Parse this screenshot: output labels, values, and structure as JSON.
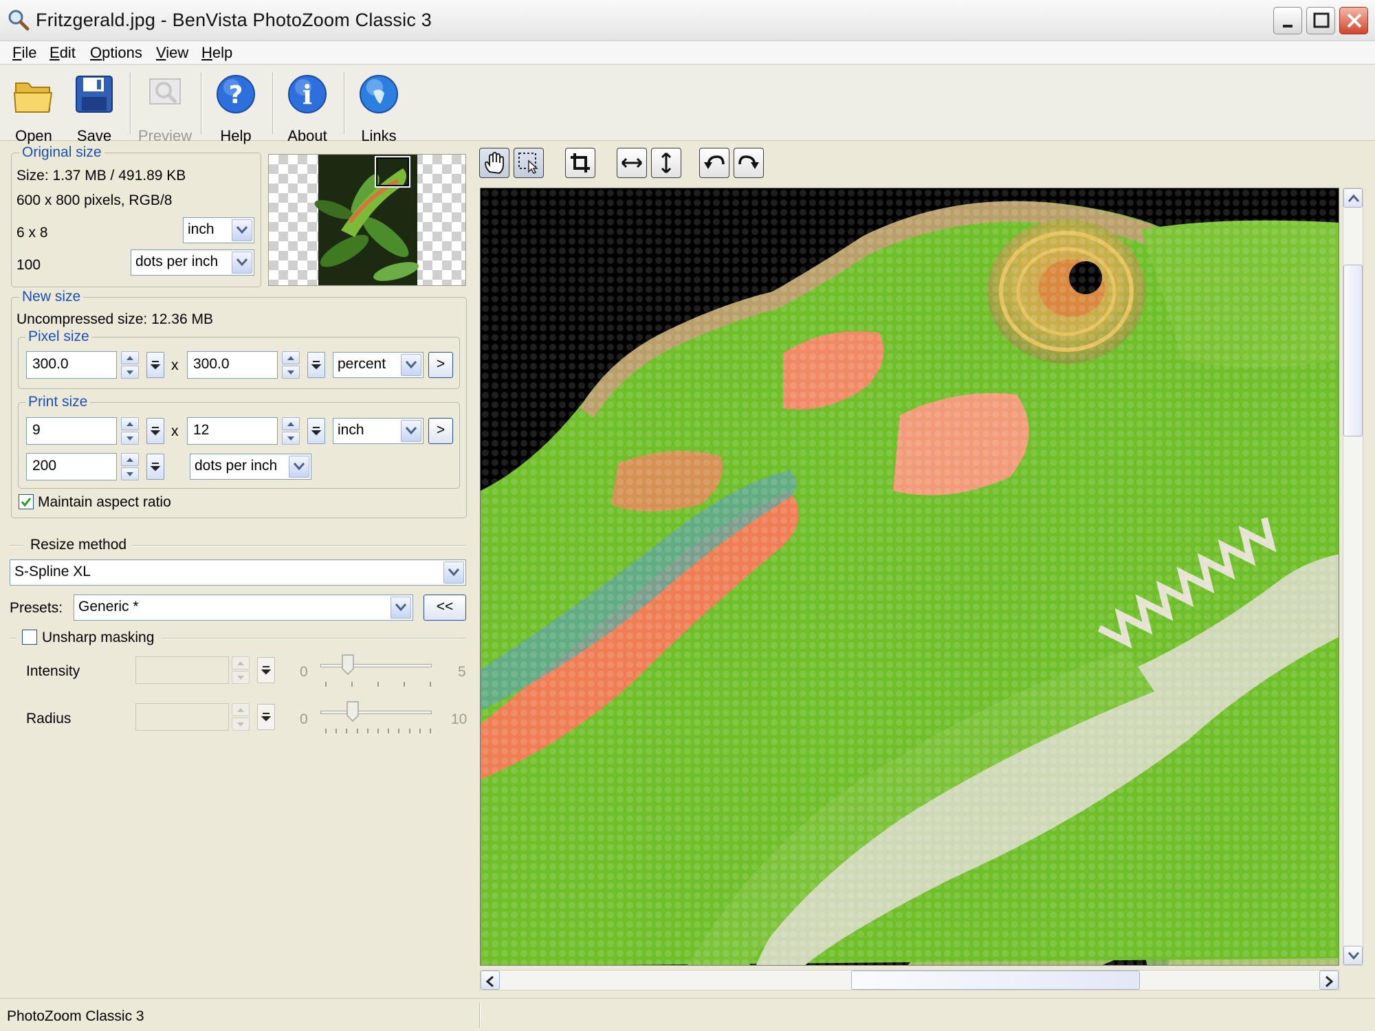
{
  "window": {
    "title": "Fritzgerald.jpg - BenVista PhotoZoom Classic 3"
  },
  "menu": {
    "file": "File",
    "edit": "Edit",
    "options": "Options",
    "view": "View",
    "help": "Help"
  },
  "toolbar": {
    "open": "Open",
    "save": "Save",
    "preview": "Preview",
    "help": "Help",
    "about": "About",
    "links": "Links"
  },
  "original_size": {
    "legend": "Original size",
    "size_line": "Size: 1.37 MB / 491.89 KB",
    "pixels_line": "600 x 800 pixels, RGB/8",
    "dimensions": "6 x 8",
    "dimension_unit": "inch",
    "resolution": "100",
    "resolution_unit": "dots per inch"
  },
  "new_size": {
    "legend": "New size",
    "uncompressed": "Uncompressed size: 12.36 MB",
    "pixel_size": {
      "legend": "Pixel size",
      "width": "300.0",
      "x_label": "x",
      "height": "300.0",
      "unit": "percent",
      "apply": ">"
    },
    "print_size": {
      "legend": "Print size",
      "width": "9",
      "x_label": "x",
      "height": "12",
      "unit": "inch",
      "apply": ">",
      "resolution": "200",
      "resolution_unit": "dots per inch"
    },
    "maintain_aspect": {
      "label": "Maintain aspect ratio",
      "checked": true
    }
  },
  "resize": {
    "heading": "Resize method",
    "method": "S-Spline XL",
    "presets_label": "Presets:",
    "preset": "Generic *",
    "presets_button": "<<"
  },
  "unsharp": {
    "label": "Unsharp masking",
    "checked": false,
    "intensity": {
      "label": "Intensity",
      "min": "0",
      "max": "5",
      "level": 0.22
    },
    "radius": {
      "label": "Radius",
      "min": "0",
      "max": "10",
      "level": 0.26
    }
  },
  "view_tools": {
    "hand": "hand-icon",
    "select": "selection-icon",
    "crop": "crop-icon",
    "fit_width": "fit-width-icon",
    "fit_height": "fit-height-icon",
    "rotate_left": "rotate-left-icon",
    "rotate_right": "rotate-right-icon"
  },
  "scrollbars": {
    "vertical_position": 0.1,
    "horizontal_position": 0.66
  },
  "status": {
    "text": "PhotoZoom Classic 3"
  },
  "colors": {
    "accent_link": "#1a4fb5",
    "face": "#ece9d8"
  }
}
